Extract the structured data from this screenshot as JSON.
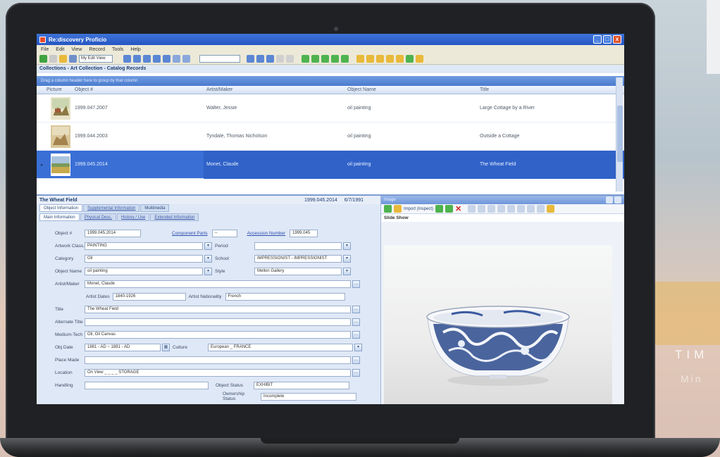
{
  "window": {
    "title": "Re:discovery Proficio",
    "minimize": "_",
    "maximize": "□",
    "close": "x"
  },
  "menu": [
    "File",
    "Edit",
    "View",
    "Record",
    "Tools",
    "Help"
  ],
  "toolbar": {
    "view_select": "My Edit View"
  },
  "breadcrumb": "Collections - Art Collection - Catalog Records",
  "grid": {
    "group_hint": "Drag a column header here to group by that column",
    "columns": [
      "Picture",
      "Object #",
      "Artist/Maker",
      "Object Name",
      "Title"
    ],
    "rows": [
      {
        "object": "1999.047.2007",
        "artist": "Walter, Jessie",
        "name": "oil painting",
        "title": "Large Cottage by a River",
        "selected": false
      },
      {
        "object": "1999.044.2003",
        "artist": "Tyndale, Thomas Nicholson",
        "name": "oil painting",
        "title": "Outside a Cottage",
        "selected": false
      },
      {
        "object": "1999.045.2014",
        "artist": "Monet, Claude",
        "name": "oil painting",
        "title": "The Wheat Field",
        "selected": true
      }
    ]
  },
  "detail": {
    "title": "The Wheat Field",
    "object_id": "1999.045.2014",
    "date": "6/7/1991",
    "tabs_top": [
      "Object Information",
      "Supplemental Information",
      "Multimedia"
    ],
    "tabs_sub": [
      "Main Information",
      "Physical Desc.",
      "History / Use",
      "Extended Information"
    ],
    "labels": {
      "object": "Object #",
      "component": "Component Parts",
      "accession": "Accession Number",
      "classification": "Artwork Class.",
      "period": "Period",
      "category": "Category",
      "school": "School",
      "object_name": "Object Name",
      "style": "Style",
      "artist": "Artist/Maker",
      "artist_dates": "Artist Dates",
      "artist_nationality": "Artist Nationality",
      "title": "Title",
      "alt_title": "Alternate Title",
      "medium": "Medium-Tech",
      "obj_date": "Obj Date",
      "culture": "Culture",
      "place_made": "Place Made",
      "location": "Location",
      "handling": "Handling",
      "object_status": "Object Status",
      "ownership": "Ownership Status"
    },
    "values": {
      "object": "1999.045.2014",
      "component": "--",
      "accession": "1999.045",
      "classification": "PAINTING",
      "period": "",
      "category": "Oil",
      "school": "IMPRESSIONIST - IMPRESSIONIST",
      "object_name": "oil painting",
      "style": "Mellon Gallery",
      "artist": "Monet, Claude",
      "artist_dates": "1840-1926",
      "artist_nationality": "French",
      "title": "The Wheat Field",
      "alt_title": "",
      "medium": "Oil, Oil Canvas",
      "obj_date": "1881 - AD ~ 1881 - AD",
      "culture": "European _ FRANCE",
      "place_made": "",
      "location": "On View _ _ _ _ STORAGE",
      "handling": "",
      "object_status": "EXHIBIT",
      "ownership": "Incomplete"
    }
  },
  "media": {
    "panel_title": "Image",
    "import": "Import (Inspect)",
    "slide_show": "Slide Show"
  },
  "background": {
    "brand_line1": "TIM",
    "brand_line2": "Min"
  },
  "colors": {
    "titlebar": "#2656c4",
    "selection": "#3a6fd6",
    "panel": "#dfe8f6"
  }
}
